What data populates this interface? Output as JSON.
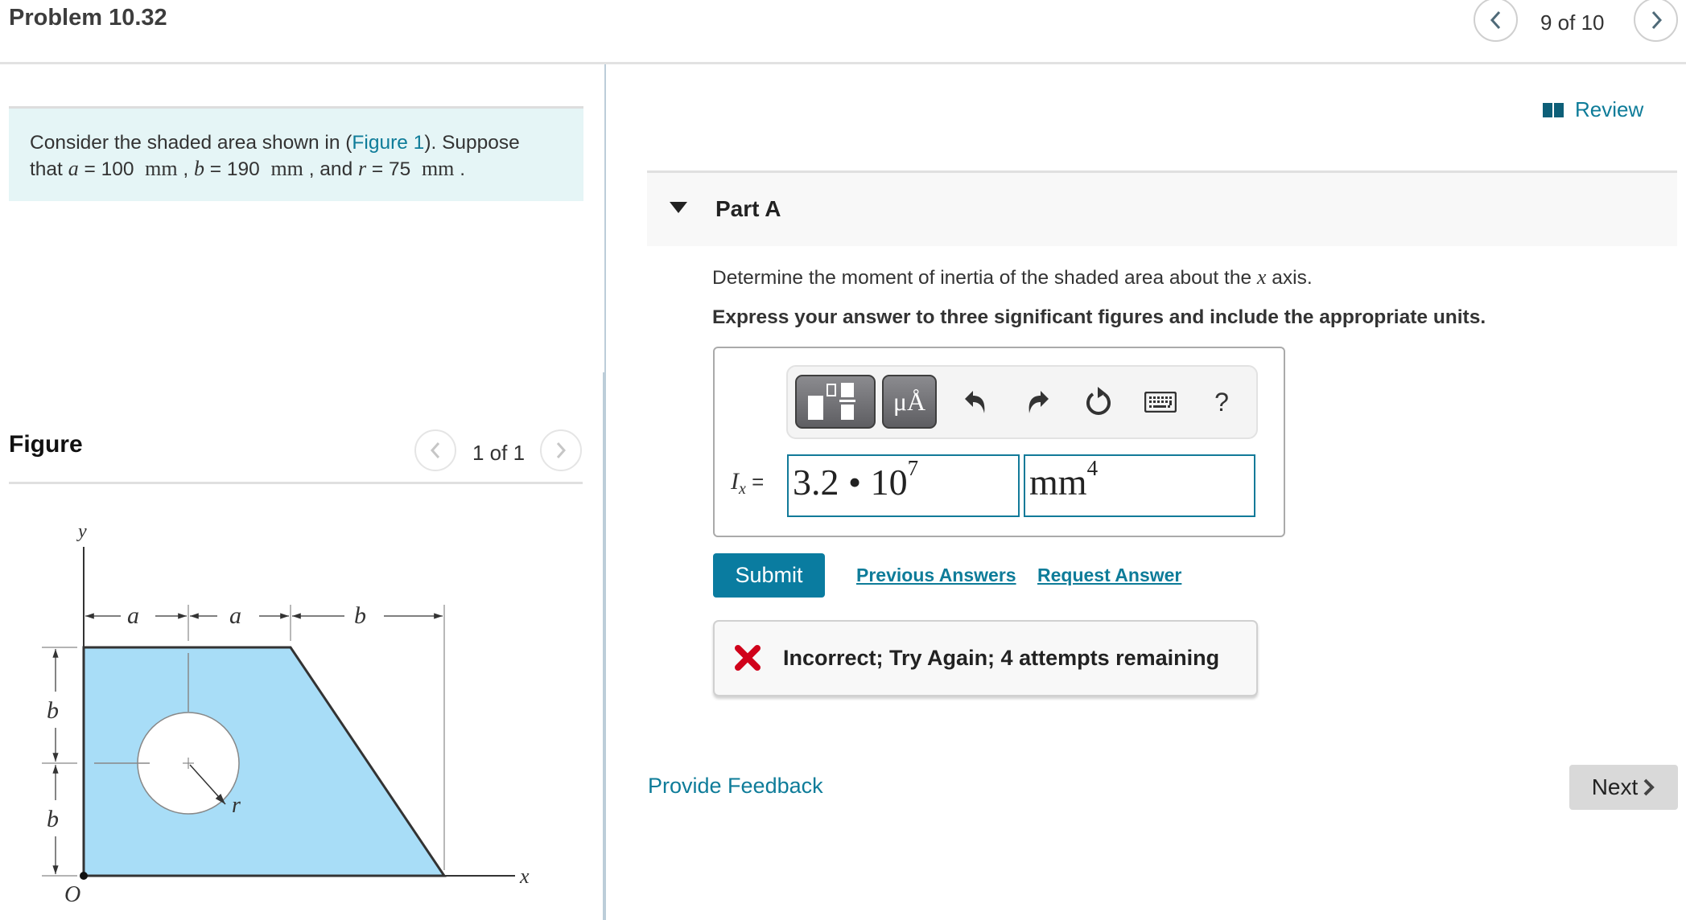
{
  "header": {
    "title": "Problem 10.32",
    "nav": {
      "count_label": "9 of 10",
      "prev_icon": "chevron-left-icon",
      "next_icon": "chevron-right-icon"
    }
  },
  "problem": {
    "text_before_link": "Consider the shaded area shown in (",
    "link_label": "Figure 1",
    "text_after_link": "). Suppose",
    "line2_that": "that ",
    "a_symbol": "a",
    "eq": " = ",
    "a_value": "100",
    "b_symbol": "b",
    "b_value": "190",
    "r_symbol": "r",
    "r_value": "75",
    "unit": "mm",
    "comma": " , ",
    "and": " , and ",
    "period": " ."
  },
  "figure": {
    "title": "Figure",
    "count_label": "1 of 1",
    "labels": {
      "y_axis": "y",
      "x_axis": "x",
      "origin": "O",
      "a1": "a",
      "a2": "a",
      "b_top": "b",
      "b_left1": "b",
      "b_left2": "b",
      "r": "r"
    },
    "fill_color": "#a8ddf7"
  },
  "review": {
    "label": "Review",
    "icon": "book-icon"
  },
  "part": {
    "label": "Part A",
    "question_before": "Determine the moment of inertia of the shaded area about the ",
    "question_var": "x",
    "question_after": " axis.",
    "instruction": "Express your answer to three significant figures and include the appropriate units."
  },
  "answer": {
    "toolbar": {
      "templates_icon": "templates-icon",
      "units_label": "μÅ",
      "undo_icon": "undo-icon",
      "redo_icon": "redo-icon",
      "reset_icon": "reset-icon",
      "keyboard_icon": "keyboard-icon",
      "help_label": "?"
    },
    "variable_main": "I",
    "variable_sub": "x",
    "equals": " =",
    "value_mantissa": "3.2 • 10",
    "value_exponent": "7",
    "units_base": "mm",
    "units_exponent": "4"
  },
  "actions": {
    "submit": "Submit",
    "previous_answers": "Previous Answers",
    "request_answer": "Request Answer"
  },
  "feedback": {
    "status": "incorrect",
    "message": "Incorrect; Try Again; 4 attempts remaining",
    "icon": "x-mark-icon",
    "icon_color": "#d0021b"
  },
  "footer": {
    "provide_feedback": "Provide Feedback",
    "next": "Next"
  },
  "colors": {
    "accent": "#0a7ca0",
    "link": "#0e7c99",
    "problem_bg": "#e5f5f6"
  }
}
